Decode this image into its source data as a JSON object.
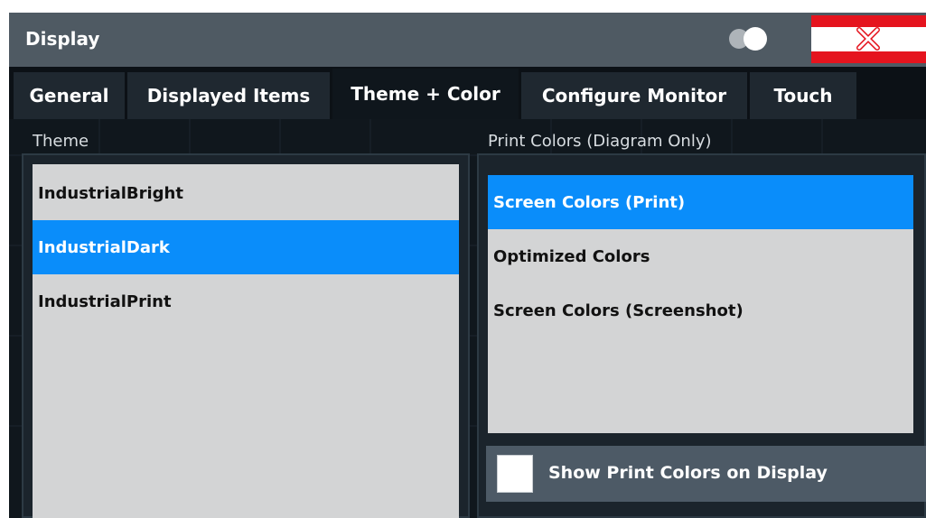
{
  "window": {
    "title": "Display"
  },
  "tabs": [
    {
      "label": "General",
      "active": false
    },
    {
      "label": "Displayed Items",
      "active": false
    },
    {
      "label": "Theme + Color",
      "active": true
    },
    {
      "label": "Configure Monitor",
      "active": false
    },
    {
      "label": "Touch",
      "active": false
    }
  ],
  "theme": {
    "label": "Theme",
    "items": [
      "IndustrialBright",
      "IndustrialDark",
      "IndustrialPrint"
    ],
    "selected": "IndustrialDark"
  },
  "print_colors": {
    "label": "Print Colors (Diagram Only)",
    "items": [
      "Screen Colors (Print)",
      "Optimized Colors",
      "Screen Colors (Screenshot)"
    ],
    "selected": "Screen Colors (Print)"
  },
  "show_print_colors": {
    "label": "Show Print Colors on Display",
    "checked": false
  },
  "colors": {
    "accent": "#0a8dfa",
    "close": "#e5141e",
    "titlebar": "#4f5a63"
  },
  "icons": {
    "toggle": "toggle-icon",
    "close": "close-x-icon"
  }
}
